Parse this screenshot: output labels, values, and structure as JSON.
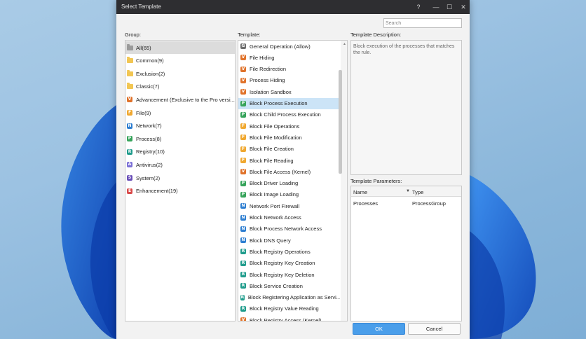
{
  "window": {
    "title": "Select Template",
    "controls": {
      "help": "?",
      "minimize": "—",
      "maximize": "☐",
      "close": "✕"
    }
  },
  "search": {
    "placeholder": "Search",
    "value": ""
  },
  "labels": {
    "group": "Group:",
    "template": "Template:",
    "description": "Template Description:",
    "parameters": "Template Parameters:"
  },
  "groups": [
    {
      "label": "All(65)",
      "icon": "folder-grey",
      "selected": true
    },
    {
      "label": "Common(9)",
      "icon": "folder"
    },
    {
      "label": "Exclusion(2)",
      "icon": "folder"
    },
    {
      "label": "Classic(7)",
      "icon": "folder"
    },
    {
      "label": "Advancement (Exclusive to the Pro versi...",
      "badge": "V",
      "color": "#e0722a"
    },
    {
      "label": "File(9)",
      "badge": "F",
      "color": "#f0a830"
    },
    {
      "label": "Network(7)",
      "badge": "N",
      "color": "#2f7fd1"
    },
    {
      "label": "Process(8)",
      "badge": "P",
      "color": "#36a35a"
    },
    {
      "label": "Registry(10)",
      "badge": "R",
      "color": "#1f9c8c"
    },
    {
      "label": "Antivirus(2)",
      "badge": "A",
      "color": "#7b6fd6"
    },
    {
      "label": "System(2)",
      "badge": "S",
      "color": "#6a4fb8"
    },
    {
      "label": "Enhancement(19)",
      "badge": "E",
      "color": "#d94a4a"
    }
  ],
  "templates": [
    {
      "label": "General Operation (Allow)",
      "badge": "G",
      "color": "#6d6d6d"
    },
    {
      "label": "File Hiding",
      "badge": "V",
      "color": "#e0722a"
    },
    {
      "label": "File Redirection",
      "badge": "V",
      "color": "#e0722a"
    },
    {
      "label": "Process Hiding",
      "badge": "V",
      "color": "#e0722a"
    },
    {
      "label": "Isolation Sandbox",
      "badge": "V",
      "color": "#e0722a"
    },
    {
      "label": "Block Process Execution",
      "badge": "P",
      "color": "#36a35a",
      "selected": true
    },
    {
      "label": "Block Child Process Execution",
      "badge": "P",
      "color": "#36a35a"
    },
    {
      "label": "Block File Operations",
      "badge": "F",
      "color": "#f0a830"
    },
    {
      "label": "Block File Modification",
      "badge": "F",
      "color": "#f0a830"
    },
    {
      "label": "Block File Creation",
      "badge": "F",
      "color": "#f0a830"
    },
    {
      "label": "Block File Reading",
      "badge": "F",
      "color": "#f0a830"
    },
    {
      "label": "Block File Access (Kernel)",
      "badge": "V",
      "color": "#e0722a"
    },
    {
      "label": "Block Driver Loading",
      "badge": "P",
      "color": "#36a35a"
    },
    {
      "label": "Block Image Loading",
      "badge": "P",
      "color": "#36a35a"
    },
    {
      "label": "Network Port Firewall",
      "badge": "N",
      "color": "#2f7fd1"
    },
    {
      "label": "Block Network Access",
      "badge": "N",
      "color": "#2f7fd1"
    },
    {
      "label": "Block Process Network Access",
      "badge": "N",
      "color": "#2f7fd1"
    },
    {
      "label": "Block DNS Query",
      "badge": "N",
      "color": "#2f7fd1"
    },
    {
      "label": "Block Registry Operations",
      "badge": "R",
      "color": "#1f9c8c"
    },
    {
      "label": "Block Registry Key Creation",
      "badge": "R",
      "color": "#1f9c8c"
    },
    {
      "label": "Block Registry Key Deletion",
      "badge": "R",
      "color": "#1f9c8c"
    },
    {
      "label": "Block Service Creation",
      "badge": "R",
      "color": "#1f9c8c"
    },
    {
      "label": "Block Registering Application as Servi...",
      "badge": "R",
      "color": "#1f9c8c"
    },
    {
      "label": "Block Registry Value Reading",
      "badge": "R",
      "color": "#1f9c8c"
    },
    {
      "label": "Block Registry Access (Kernel)",
      "badge": "V",
      "color": "#e0722a"
    }
  ],
  "description": "Block execution of the processes that matches the rule.",
  "parameters": {
    "columns": {
      "name": "Name",
      "type": "Type",
      "sort_arrow": "▼"
    },
    "rows": [
      {
        "name": "Processes",
        "type": "ProcessGroup"
      }
    ]
  },
  "buttons": {
    "ok": "OK",
    "cancel": "Cancel"
  }
}
